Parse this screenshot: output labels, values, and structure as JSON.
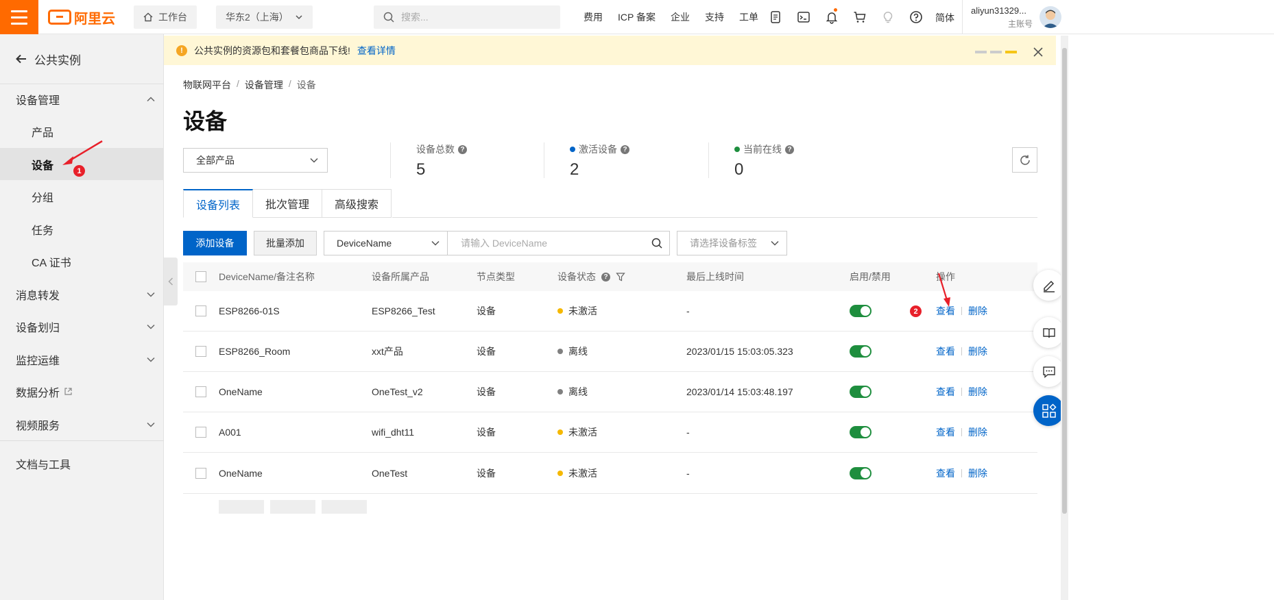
{
  "topbar": {
    "brand": "阿里云",
    "workspace_label": "工作台",
    "region_label": "华东2（上海）",
    "search_placeholder": "搜索...",
    "nav_links": [
      "费用",
      "ICP 备案",
      "企业",
      "支持",
      "工单"
    ],
    "language": "简体",
    "account_name": "aliyun31329...",
    "account_role": "主账号"
  },
  "sidebar": {
    "back_label": "公共实例",
    "items": [
      {
        "label": "设备管理",
        "expanded": true
      },
      {
        "label": "产品"
      },
      {
        "label": "设备",
        "active": true
      },
      {
        "label": "分组"
      },
      {
        "label": "任务"
      },
      {
        "label": "CA 证书"
      },
      {
        "label": "消息转发"
      },
      {
        "label": "设备划归"
      },
      {
        "label": "监控运维"
      },
      {
        "label": "数据分析"
      },
      {
        "label": "视频服务"
      },
      {
        "label": "文档与工具"
      }
    ]
  },
  "notice": {
    "text": "公共实例的资源包和套餐包商品下线!",
    "link": "查看详情"
  },
  "breadcrumb": [
    "物联网平台",
    "设备管理",
    "设备"
  ],
  "page_title": "设备",
  "product_filter": "全部产品",
  "stats": [
    {
      "label": "设备总数",
      "value": "5"
    },
    {
      "label": "激活设备",
      "value": "2",
      "dot_color": "#0064c8"
    },
    {
      "label": "当前在线",
      "value": "0",
      "dot_color": "#1e8e3e"
    }
  ],
  "tabs": [
    "设备列表",
    "批次管理",
    "高级搜索"
  ],
  "toolbar": {
    "add_button": "添加设备",
    "batch_add_button": "批量添加",
    "field_select": "DeviceName",
    "search_placeholder": "请输入 DeviceName",
    "tag_placeholder": "请选择设备标签"
  },
  "table": {
    "columns": [
      "DeviceName/备注名称",
      "设备所属产品",
      "节点类型",
      "设备状态",
      "最后上线时间",
      "启用/禁用",
      "操作"
    ],
    "rows": [
      {
        "name": "ESP8266-01S",
        "product": "ESP8266_Test",
        "node": "设备",
        "status": "未激活",
        "status_color": "#f5b800",
        "last_online": "-",
        "enabled": true
      },
      {
        "name": "ESP8266_Room",
        "product": "xxt产品",
        "node": "设备",
        "status": "离线",
        "status_color": "#808080",
        "last_online": "2023/01/15 15:03:05.323",
        "enabled": true
      },
      {
        "name": "OneName",
        "product": "OneTest_v2",
        "node": "设备",
        "status": "离线",
        "status_color": "#808080",
        "last_online": "2023/01/14 15:03:48.197",
        "enabled": true
      },
      {
        "name": "A001",
        "product": "wifi_dht11",
        "node": "设备",
        "status": "未激活",
        "status_color": "#f5b800",
        "last_online": "-",
        "enabled": true
      },
      {
        "name": "OneName",
        "product": "OneTest",
        "node": "设备",
        "status": "未激活",
        "status_color": "#f5b800",
        "last_online": "-",
        "enabled": true
      }
    ],
    "view_label": "查看",
    "delete_label": "删除"
  },
  "annotations": {
    "badge_1": "1",
    "badge_2": "2"
  },
  "colors": {
    "brand": "#ff6a00",
    "primary": "#0064c8",
    "enabled": "#1e8e3e",
    "annotation": "#e8202a"
  }
}
